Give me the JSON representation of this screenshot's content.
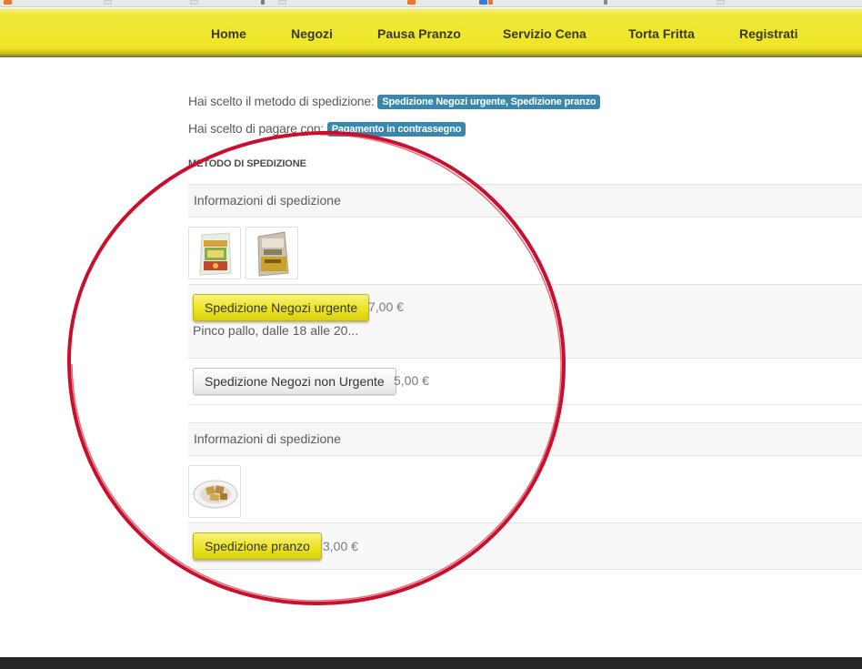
{
  "browser": {
    "favicon_colors": [
      "#e8762d",
      "#e3e3e3",
      "#e3e3e3",
      "#777777",
      "#e3e3e3",
      "#e8762d",
      "#e8762d",
      "#3b78d4",
      "#e3e3e3",
      "#888888"
    ]
  },
  "nav": {
    "items": [
      "Home",
      "Negozi",
      "Pausa Pranzo",
      "Servizio Cena",
      "Torta Fritta",
      "Registrati"
    ]
  },
  "summary": {
    "shipping_prefix": "Hai scelto il metodo di spedizione:",
    "shipping_value": "Spedizione Negozi urgente, Spedizione pranzo",
    "payment_prefix": "Hai scelto di pagare con:",
    "payment_value": "Pagamento in contrassegno"
  },
  "section_title": "METODO DI SPEDIZIONE",
  "groups": [
    {
      "header": "Informazioni di spedizione",
      "product_images": [
        "pasta-bag-product-image",
        "sauce-bag-product-image"
      ],
      "options": [
        {
          "label": "Spedizione Negozi urgente",
          "price": "7,00 €",
          "selected": true,
          "description": "Pinco pallo, dalle 18 alle 20..."
        },
        {
          "label": "Spedizione Negozi non Urgente",
          "price": "5,00 €",
          "selected": false
        }
      ]
    },
    {
      "header": "Informazioni di spedizione",
      "product_images": [
        "food-plate-product-image"
      ],
      "options": [
        {
          "label": "Spedizione pranzo",
          "price": "3,00 €",
          "selected": true
        }
      ]
    }
  ],
  "colors": {
    "nav_yellow": "#efe627",
    "badge_blue": "#3a87ad",
    "annotation_red": "#c8102e",
    "footer": "#262626"
  }
}
